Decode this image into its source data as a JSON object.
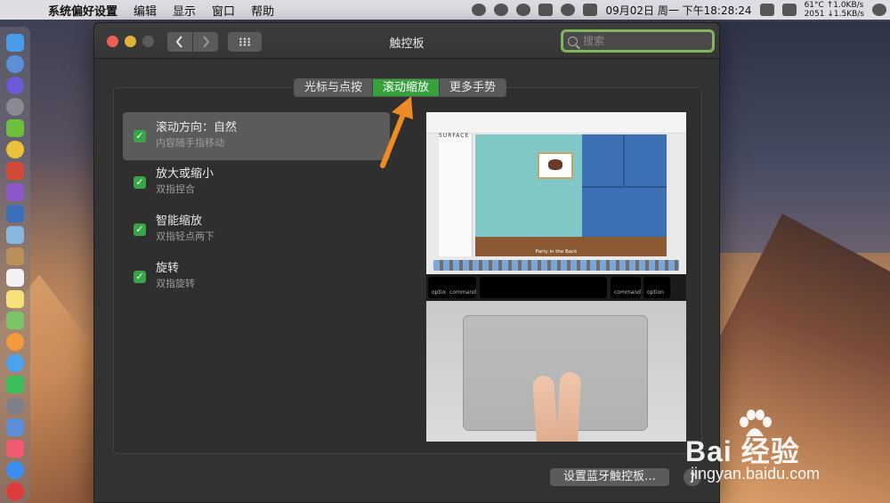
{
  "menubar": {
    "app_name": "系统偏好设置",
    "menus": [
      "编辑",
      "显示",
      "窗口",
      "帮助"
    ],
    "clock": "09月02日 周一 下午18:28:24",
    "temp": "61°C",
    "fan": "2051",
    "upload": "↑1.0KB/s",
    "download": "↓1.5KB/s"
  },
  "window": {
    "title": "触控板",
    "search_placeholder": "搜索"
  },
  "tabs": [
    "光标与点按",
    "滚动缩放",
    "更多手势"
  ],
  "active_tab": "滚动缩放",
  "options": [
    {
      "label": "滚动方向：自然",
      "sub": "内容随手指移动",
      "checked": true
    },
    {
      "label": "放大或缩小",
      "sub": "双指捏合",
      "checked": true
    },
    {
      "label": "智能缩放",
      "sub": "双指轻点两下",
      "checked": true
    },
    {
      "label": "旋转",
      "sub": "双指旋转",
      "checked": true
    }
  ],
  "preview": {
    "brand": "SURFACE",
    "caption": "Party in the Back",
    "keys": {
      "option_left": "option",
      "command_left": "command",
      "command_right": "command",
      "option_right": "option"
    }
  },
  "footer": {
    "bt_button": "设置蓝牙触控板…",
    "help": "?"
  },
  "watermark": {
    "brand": "Bai  经验",
    "url": "jingyan.baidu.com"
  },
  "colors": {
    "accent_green": "#37a13e",
    "search_border": "#7fb65e",
    "arrow": "#f08a24"
  }
}
